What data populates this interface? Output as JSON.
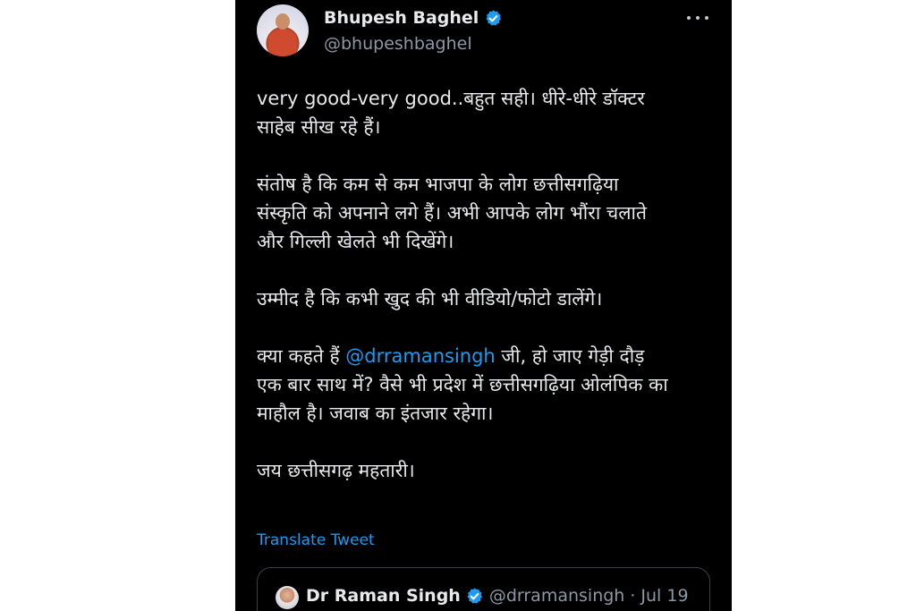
{
  "tweet": {
    "author_name": "Bhupesh Baghel",
    "author_handle": "@bhupeshbaghel",
    "paragraphs": [
      "very good-very good..बहुत सही। धीरे-धीरे डॉक्टर\nसाहेब सीख रहे हैं।",
      "संतोष है कि कम से कम भाजपा के लोग छत्तीसगढ़िया\nसंस्कृति को अपनाने लगे हैं। अभी आपके लोग भौंरा चलाते\nऔर गिल्ली खेलते भी दिखेंगे।",
      "उम्मीद है कि कभी खुद की भी वीडियो/फोटो डालेंगे।"
    ],
    "mention_paragraph": {
      "before": "क्या कहते हैं ",
      "mention": "@drramansingh",
      "after": " जी, हो जाए गेड़ी दौड़\nएक बार साथ में? वैसे भी प्रदेश में छत्तीसगढ़िया ओलंपिक का\nमाहौल है। जवाब का इंतजार रहेगा।"
    },
    "closing": "जय छत्तीसगढ़ महतारी।",
    "translate_label": "Translate Tweet"
  },
  "quoted_tweet": {
    "author_name": "Dr Raman Singh",
    "author_handle": "@drramansingh",
    "separator": "·",
    "date": "Jul 19"
  },
  "icons": {
    "verified": "verified-badge-icon",
    "more": "more-options-icon"
  },
  "colors": {
    "background": "#000000",
    "text": "#e7e9ea",
    "secondary_text": "#8b98a5",
    "link": "#1d9bf0",
    "verified": "#1d9bf0"
  }
}
